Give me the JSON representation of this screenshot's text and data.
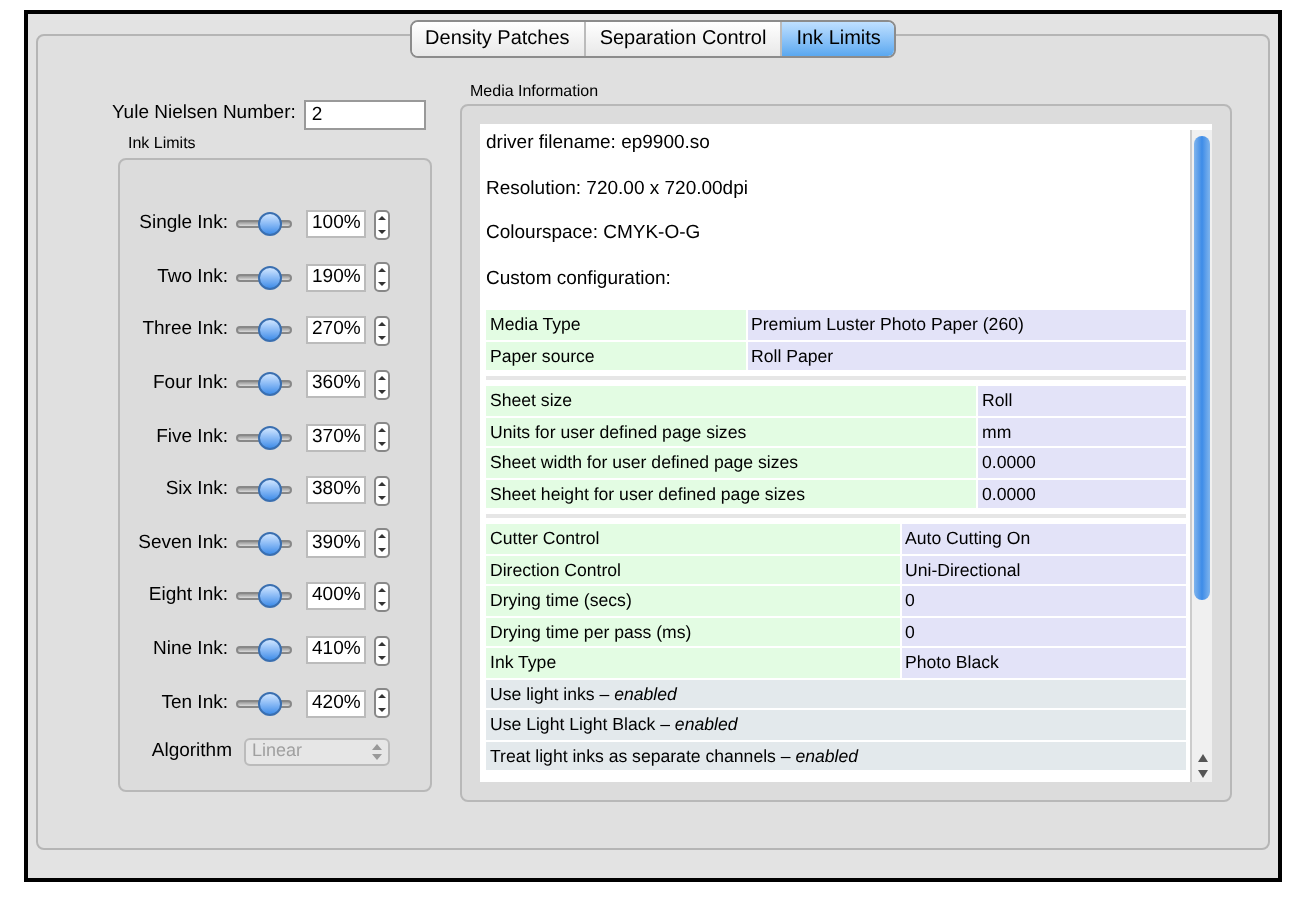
{
  "tabs": [
    {
      "label": "Density Patches",
      "selected": false
    },
    {
      "label": "Separation Control",
      "selected": false
    },
    {
      "label": "Ink Limits",
      "selected": true
    }
  ],
  "yule": {
    "label": "Yule Nielsen Number:",
    "value": "2"
  },
  "ink_limits": {
    "title": "Ink Limits",
    "rows": [
      {
        "label": "Single Ink:",
        "level": 0.6,
        "value": "100%"
      },
      {
        "label": "Two Ink:",
        "level": 0.6,
        "value": "190%"
      },
      {
        "label": "Three Ink:",
        "level": 0.6,
        "value": "270%"
      },
      {
        "label": "Four Ink:",
        "level": 0.6,
        "value": "360%"
      },
      {
        "label": "Five Ink:",
        "level": 0.6,
        "value": "370%"
      },
      {
        "label": "Six Ink:",
        "level": 0.6,
        "value": "380%"
      },
      {
        "label": "Seven Ink:",
        "level": 0.6,
        "value": "390%"
      },
      {
        "label": "Eight Ink:",
        "level": 0.6,
        "value": "400%"
      },
      {
        "label": "Nine Ink:",
        "level": 0.6,
        "value": "410%"
      },
      {
        "label": "Ten Ink:",
        "level": 0.6,
        "value": "420%"
      }
    ],
    "algorithm": {
      "label": "Algorithm",
      "value": "Linear",
      "disabled": true
    }
  },
  "media": {
    "title": "Media Information",
    "lines": [
      "driver filename: ep9900.so",
      "Resolution: 720.00 x 720.00dpi",
      "Colourspace: CMYK-O-G",
      "Custom configuration:"
    ],
    "sections": [
      {
        "rows": [
          {
            "kind": "pair",
            "name": "Media Type",
            "value": "Premium Luster Photo Paper (260)"
          },
          {
            "kind": "pair",
            "name": "Paper source",
            "value": "Roll Paper"
          }
        ]
      },
      {
        "rows": [
          {
            "kind": "pair",
            "name": "Sheet size",
            "value": "Roll"
          },
          {
            "kind": "pair",
            "name": "Units for user defined page sizes",
            "value": "mm"
          },
          {
            "kind": "pair",
            "name": "Sheet width for user defined page sizes",
            "value": "0.0000"
          },
          {
            "kind": "pair",
            "name": "Sheet height for user defined page sizes",
            "value": "0.0000"
          }
        ]
      },
      {
        "rows": [
          {
            "kind": "pair",
            "name": "Cutter Control",
            "value": "Auto Cutting On"
          },
          {
            "kind": "pair",
            "name": "Direction Control",
            "value": "Uni-Directional"
          },
          {
            "kind": "pair",
            "name": "Drying time (secs)",
            "value": "0"
          },
          {
            "kind": "pair",
            "name": "Drying time per pass (ms)",
            "value": "0"
          },
          {
            "kind": "pair",
            "name": "Ink Type",
            "value": "Photo Black"
          },
          {
            "kind": "flag",
            "name": "Use light inks – *enabled*"
          },
          {
            "kind": "flag",
            "name": "Use Light Light Black – *enabled*"
          },
          {
            "kind": "flag",
            "name": "Treat light inks as separate channels – *enabled*"
          }
        ]
      }
    ]
  }
}
